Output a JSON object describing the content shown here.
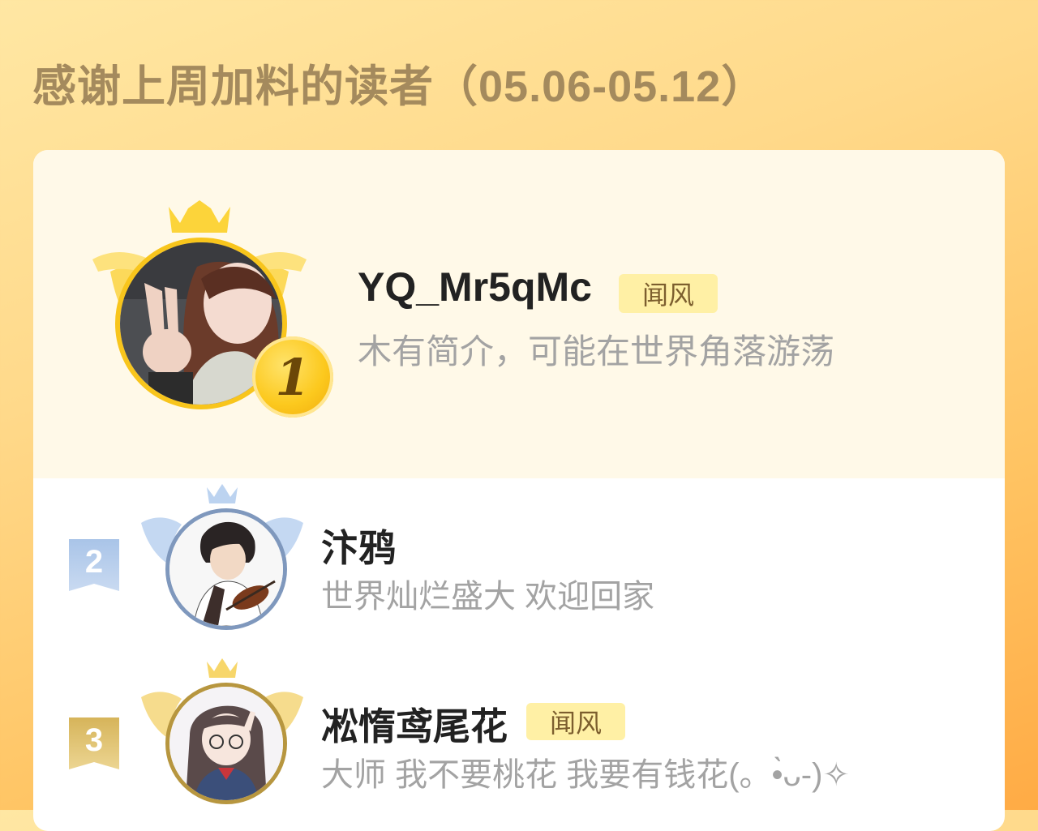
{
  "header": {
    "title": "感谢上周加料的读者（05.06-05.12）"
  },
  "leaderboard": [
    {
      "rank": "1",
      "name": "YQ_Mr5qMc",
      "badge": "闻风",
      "bio": "木有简介，可能在世界角落游荡",
      "icon": "gold-crown-icon"
    },
    {
      "rank": "2",
      "name": "汴鸦",
      "badge": "",
      "bio": "世界灿烂盛大 欢迎回家",
      "icon": "silver-crown-icon"
    },
    {
      "rank": "3",
      "name": "凇惰鸢尾花",
      "badge": "闻风",
      "bio": "大师 我不要桃花 我要有钱花(。•̀ᴗ-)✧",
      "icon": "bronze-crown-icon"
    }
  ],
  "colors": {
    "gold": "#f8c51c",
    "silver": "#a8c3e6",
    "bronze": "#d8b65c",
    "title": "#a48a5d",
    "badge_bg": "#fff0a5"
  }
}
